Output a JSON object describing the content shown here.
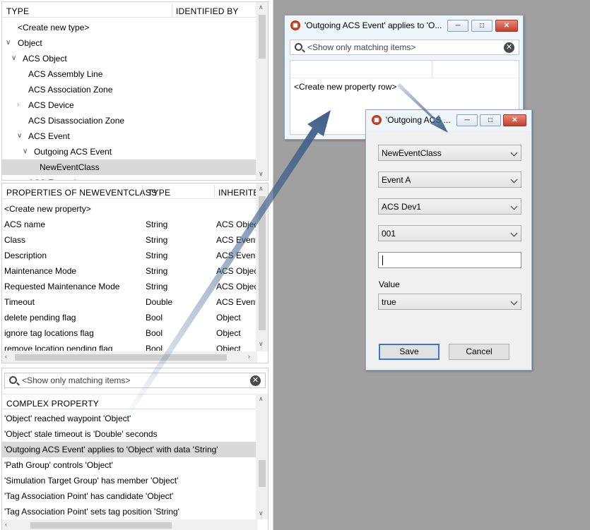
{
  "type_panel": {
    "col_type": "TYPE",
    "col_identified_by": "IDENTIFIED BY",
    "items": [
      {
        "label": "<Create new type>"
      },
      {
        "label": "Object"
      },
      {
        "label": "ACS Object"
      },
      {
        "label": "ACS Assembly Line"
      },
      {
        "label": "ACS Association Zone"
      },
      {
        "label": "ACS Device"
      },
      {
        "label": "ACS Disassociation Zone"
      },
      {
        "label": "ACS Event"
      },
      {
        "label": "Outgoing ACS Event"
      },
      {
        "label": "NewEventClass"
      },
      {
        "label": "ACS Exception"
      }
    ]
  },
  "properties_panel": {
    "col_name": "PROPERTIES OF NEWEVENTCLASS",
    "col_type": "TYPE",
    "col_inherited": "INHERITED",
    "rows": [
      {
        "name": "<Create new property>",
        "type": "",
        "inherited": ""
      },
      {
        "name": "ACS name",
        "type": "String",
        "inherited": "ACS Objec"
      },
      {
        "name": "Class",
        "type": "String",
        "inherited": "ACS Event"
      },
      {
        "name": "Description",
        "type": "String",
        "inherited": "ACS Event"
      },
      {
        "name": "Maintenance Mode",
        "type": "String",
        "inherited": "ACS Objec"
      },
      {
        "name": "Requested Maintenance Mode",
        "type": "String",
        "inherited": "ACS Objec"
      },
      {
        "name": "Timeout",
        "type": "Double",
        "inherited": "ACS Event"
      },
      {
        "name": "delete pending flag",
        "type": "Bool",
        "inherited": "Object"
      },
      {
        "name": "ignore tag locations flag",
        "type": "Bool",
        "inherited": "Object"
      },
      {
        "name": "remove location pending flag",
        "type": "Bool",
        "inherited": "Object"
      }
    ]
  },
  "complex_panel": {
    "search_placeholder": "<Show only matching items>",
    "col_header": "COMPLEX PROPERTY",
    "rows": [
      {
        "label": "'Object' reached waypoint 'Object'"
      },
      {
        "label": "'Object' stale timeout is 'Double' seconds"
      },
      {
        "label": "'Outgoing ACS Event' applies to 'Object' with data 'String'"
      },
      {
        "label": "'Path Group' controls 'Object'"
      },
      {
        "label": "'Simulation Target Group' has member 'Object'"
      },
      {
        "label": "'Tag Association Point' has candidate 'Object'"
      },
      {
        "label": "'Tag Association Point' sets tag position 'String'"
      }
    ]
  },
  "dialog1": {
    "title": "'Outgoing ACS Event' applies to 'O...",
    "search_placeholder": "<Show only matching items>",
    "create_row": "<Create new property row>"
  },
  "dialog2": {
    "title": "'Outgoing ACS ...",
    "combo1": "NewEventClass",
    "combo2": "Event A",
    "combo3": "ACS Dev1",
    "combo4": "001",
    "text_value": "",
    "value_label": "Value",
    "value_combo": "true",
    "save_label": "Save",
    "cancel_label": "Cancel"
  },
  "icons": {
    "minimize": "─",
    "maximize": "□",
    "close": "✕"
  }
}
